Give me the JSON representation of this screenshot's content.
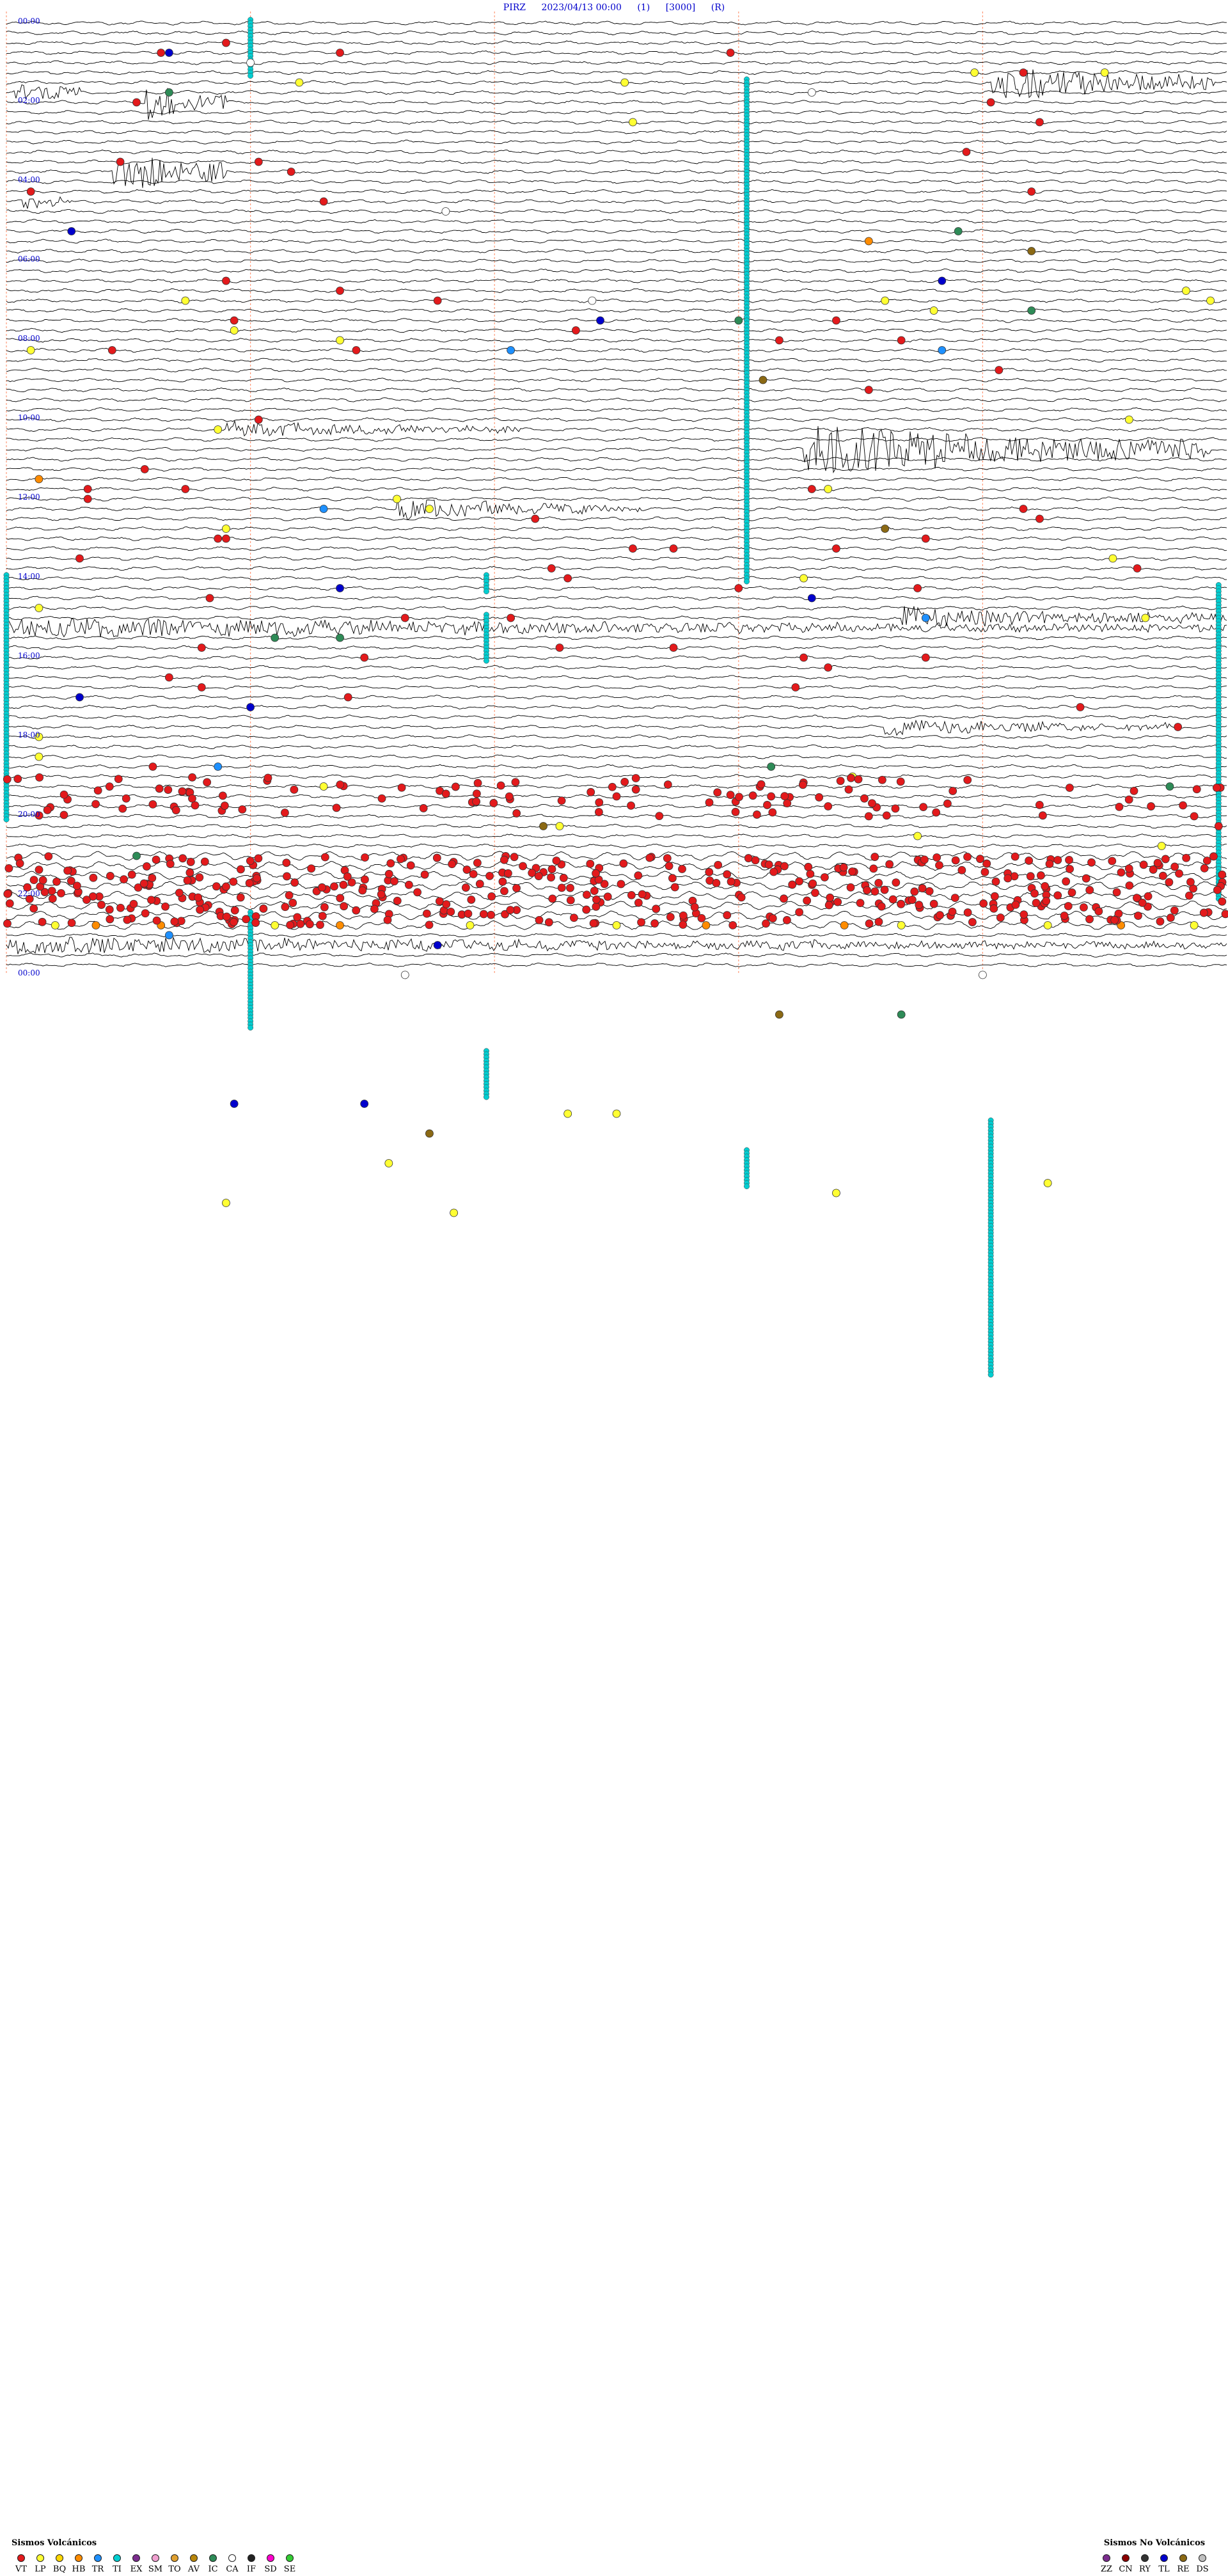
{
  "header": {
    "station": "PIRZ",
    "datetime": "2023/04/13 00:00",
    "channel": "(1)",
    "gain": "[3000]",
    "mode": "(R)"
  },
  "hour_labels": [
    "00:00",
    "02:00",
    "04:00",
    "06:00",
    "08:00",
    "10:00",
    "12:00",
    "14:00",
    "16:00",
    "18:00",
    "20:00",
    "22:00",
    "00:00"
  ],
  "legend_volcanic": {
    "title": "Sismos Volcánicos",
    "items": [
      {
        "code": "VT",
        "color": "#e31a1c"
      },
      {
        "code": "LP",
        "color": "#ffff33"
      },
      {
        "code": "BQ",
        "color": "#ffd700"
      },
      {
        "code": "HB",
        "color": "#ff8c00"
      },
      {
        "code": "TR",
        "color": "#1e90ff"
      },
      {
        "code": "TI",
        "color": "#00ced1"
      },
      {
        "code": "EX",
        "color": "#7b2d8e"
      },
      {
        "code": "SM",
        "color": "#f0a0d0"
      },
      {
        "code": "TO",
        "color": "#e0a030"
      },
      {
        "code": "AV",
        "color": "#b8860b"
      },
      {
        "code": "IC",
        "color": "#2e8b57"
      },
      {
        "code": "CA",
        "color": "#ffffff"
      },
      {
        "code": "IF",
        "color": "#222222"
      },
      {
        "code": "SD",
        "color": "#ff00cc"
      },
      {
        "code": "SE",
        "color": "#33cc33"
      }
    ]
  },
  "legend_nonvolcanic": {
    "title": "Sismos No Volcánicos",
    "items": [
      {
        "code": "ZZ",
        "color": "#7b2d8e"
      },
      {
        "code": "CN",
        "color": "#8b0000"
      },
      {
        "code": "RY",
        "color": "#333333"
      },
      {
        "code": "TL",
        "color": "#0000cc"
      },
      {
        "code": "RE",
        "color": "#8b6914"
      },
      {
        "code": "DS",
        "color": "#c0c0c0"
      }
    ]
  },
  "chart_data": {
    "type": "helicorder",
    "station": "PIRZ",
    "start": "2023/04/13 00:00",
    "rows_per_hour": 4,
    "minutes_per_row": 15,
    "hours": 24,
    "trace_color": "#000000",
    "minute_marker_color": "#ff9977",
    "minute_markers": [
      0,
      3,
      6,
      9,
      12
    ],
    "colors": {
      "VT": "#e31a1c",
      "LP": "#ffff33",
      "HB": "#ff8c00",
      "TR": "#1e90ff",
      "TI": "#00ced1",
      "IC": "#2e8b57",
      "CA": "#ffffff",
      "TL": "#0000cc",
      "RE": "#8b6914"
    },
    "long_events": [
      {
        "code": "TI",
        "minute": 3.0,
        "row_start": 0,
        "row_end": 5
      },
      {
        "code": "TI",
        "minute": 9.1,
        "row_start": 6,
        "row_end": 56
      },
      {
        "code": "TI",
        "minute": 5.9,
        "row_start": 56,
        "row_end": 57
      },
      {
        "code": "TI",
        "minute": 5.9,
        "row_start": 60,
        "row_end": 64
      },
      {
        "code": "TI",
        "minute": 3.0,
        "row_start": 90,
        "row_end": 101
      },
      {
        "code": "TI",
        "minute": 5.9,
        "row_start": 104,
        "row_end": 108
      },
      {
        "code": "TI",
        "minute": 9.1,
        "row_start": 114,
        "row_end": 117
      },
      {
        "code": "TI",
        "minute": 12.1,
        "row_start": 111,
        "row_end": 136
      },
      {
        "code": "TI",
        "minute": 0.0,
        "row_start": 56,
        "row_end": 80
      },
      {
        "code": "TI",
        "minute": 14.9,
        "row_start": 57,
        "row_end": 88
      }
    ],
    "bursts": [
      {
        "minute": 1.7,
        "row": 8,
        "amp": 26,
        "width": 1.0
      },
      {
        "minute": 0.1,
        "row": 7,
        "amp": 14,
        "width": 0.8
      },
      {
        "minute": 1.3,
        "row": 15,
        "amp": 30,
        "width": 1.4
      },
      {
        "minute": 0.2,
        "row": 18,
        "amp": 10,
        "width": 0.6
      },
      {
        "minute": 2.7,
        "row": 41,
        "amp": 10,
        "width": 3.6
      },
      {
        "minute": 9.8,
        "row": 43,
        "amp": 32,
        "width": 5.0
      },
      {
        "minute": 4.8,
        "row": 49,
        "amp": 12,
        "width": 3.0
      },
      {
        "minute": 12.1,
        "row": 6,
        "amp": 22,
        "width": 2.8
      },
      {
        "minute": 11.0,
        "row": 60,
        "amp": 14,
        "width": 4.0
      },
      {
        "minute": 0.0,
        "row": 61,
        "amp": 12,
        "width": 15
      },
      {
        "minute": 10.8,
        "row": 71,
        "amp": 10,
        "width": 3.5
      },
      {
        "minute": 0.0,
        "row": 93,
        "amp": 10,
        "width": 15
      },
      {
        "minute": 10.4,
        "row": 102,
        "amp": 20,
        "width": 3.8
      }
    ],
    "events": [
      {
        "code": "VT",
        "minute": 1.9,
        "row": 3
      },
      {
        "code": "VT",
        "minute": 4.1,
        "row": 3
      },
      {
        "code": "VT",
        "minute": 8.9,
        "row": 3
      },
      {
        "code": "VT",
        "minute": 2.7,
        "row": 2
      },
      {
        "code": "LP",
        "minute": 3.6,
        "row": 6
      },
      {
        "code": "LP",
        "minute": 7.6,
        "row": 6
      },
      {
        "code": "LP",
        "minute": 11.9,
        "row": 5
      },
      {
        "code": "LP",
        "minute": 13.5,
        "row": 5
      },
      {
        "code": "VT",
        "minute": 12.5,
        "row": 5
      },
      {
        "code": "VT",
        "minute": 12.1,
        "row": 8
      },
      {
        "code": "VT",
        "minute": 1.6,
        "row": 8
      },
      {
        "code": "VT",
        "minute": 3.1,
        "row": 14
      },
      {
        "code": "VT",
        "minute": 12.7,
        "row": 10
      },
      {
        "code": "VT",
        "minute": 3.5,
        "row": 15
      },
      {
        "code": "VT",
        "minute": 0.3,
        "row": 17
      },
      {
        "code": "VT",
        "minute": 3.9,
        "row": 18
      },
      {
        "code": "VT",
        "minute": 1.4,
        "row": 14
      },
      {
        "code": "VT",
        "minute": 11.8,
        "row": 13
      },
      {
        "code": "VT",
        "minute": 12.6,
        "row": 17
      },
      {
        "code": "TL",
        "minute": 0.8,
        "row": 21
      },
      {
        "code": "TL",
        "minute": 2.0,
        "row": 3
      },
      {
        "code": "TL",
        "minute": 11.5,
        "row": 26
      },
      {
        "code": "TL",
        "minute": 7.3,
        "row": 30
      },
      {
        "code": "TL",
        "minute": 4.1,
        "row": 57
      },
      {
        "code": "TL",
        "minute": 3.0,
        "row": 69
      },
      {
        "code": "TL",
        "minute": 9.9,
        "row": 58
      },
      {
        "code": "TL",
        "minute": 0.9,
        "row": 68
      },
      {
        "code": "TL",
        "minute": 4.4,
        "row": 109
      },
      {
        "code": "TL",
        "minute": 2.8,
        "row": 109
      },
      {
        "code": "TL",
        "minute": 5.3,
        "row": 93
      },
      {
        "code": "IC",
        "minute": 2.0,
        "row": 7
      },
      {
        "code": "IC",
        "minute": 11.7,
        "row": 21
      },
      {
        "code": "IC",
        "minute": 12.6,
        "row": 29
      },
      {
        "code": "IC",
        "minute": 9.0,
        "row": 30
      },
      {
        "code": "IC",
        "minute": 3.3,
        "row": 62
      },
      {
        "code": "IC",
        "minute": 9.4,
        "row": 75
      },
      {
        "code": "IC",
        "minute": 14.3,
        "row": 77
      },
      {
        "code": "IC",
        "minute": 4.1,
        "row": 62
      },
      {
        "code": "IC",
        "minute": 1.6,
        "row": 84
      },
      {
        "code": "IC",
        "minute": 11.0,
        "row": 100
      },
      {
        "code": "TR",
        "minute": 6.2,
        "row": 33
      },
      {
        "code": "TR",
        "minute": 11.5,
        "row": 33
      },
      {
        "code": "TR",
        "minute": 3.9,
        "row": 49
      },
      {
        "code": "TR",
        "minute": 11.3,
        "row": 60
      },
      {
        "code": "TR",
        "minute": 2.0,
        "row": 92
      },
      {
        "code": "TR",
        "minute": 2.6,
        "row": 75
      },
      {
        "code": "RE",
        "minute": 12.6,
        "row": 23
      },
      {
        "code": "RE",
        "minute": 9.3,
        "row": 36
      },
      {
        "code": "RE",
        "minute": 9.5,
        "row": 100
      },
      {
        "code": "RE",
        "minute": 5.2,
        "row": 112
      },
      {
        "code": "RE",
        "minute": 6.6,
        "row": 81
      },
      {
        "code": "RE",
        "minute": 10.8,
        "row": 51
      },
      {
        "code": "HB",
        "minute": 1.9,
        "row": 91
      },
      {
        "code": "HB",
        "minute": 1.1,
        "row": 91
      },
      {
        "code": "HB",
        "minute": 8.6,
        "row": 91
      },
      {
        "code": "HB",
        "minute": 10.3,
        "row": 91
      },
      {
        "code": "HB",
        "minute": 13.7,
        "row": 91
      },
      {
        "code": "HB",
        "minute": 4.1,
        "row": 91
      },
      {
        "code": "HB",
        "minute": 10.6,
        "row": 22
      },
      {
        "code": "HB",
        "minute": 0.4,
        "row": 46
      },
      {
        "code": "CA",
        "minute": 3.0,
        "row": 4
      },
      {
        "code": "CA",
        "minute": 9.9,
        "row": 7
      },
      {
        "code": "CA",
        "minute": 5.4,
        "row": 19
      },
      {
        "code": "CA",
        "minute": 7.2,
        "row": 28
      },
      {
        "code": "CA",
        "minute": 4.9,
        "row": 96
      },
      {
        "code": "CA",
        "minute": 12.0,
        "row": 96
      },
      {
        "code": "LP",
        "minute": 7.7,
        "row": 10
      },
      {
        "code": "LP",
        "minute": 2.2,
        "row": 28
      },
      {
        "code": "LP",
        "minute": 2.8,
        "row": 31
      },
      {
        "code": "LP",
        "minute": 4.1,
        "row": 32
      },
      {
        "code": "LP",
        "minute": 10.8,
        "row": 28
      },
      {
        "code": "LP",
        "minute": 11.4,
        "row": 29
      },
      {
        "code": "LP",
        "minute": 14.5,
        "row": 27
      },
      {
        "code": "LP",
        "minute": 14.8,
        "row": 28
      },
      {
        "code": "LP",
        "minute": 0.3,
        "row": 33
      },
      {
        "code": "LP",
        "minute": 2.6,
        "row": 41
      },
      {
        "code": "LP",
        "minute": 13.8,
        "row": 40
      },
      {
        "code": "LP",
        "minute": 10.1,
        "row": 47
      },
      {
        "code": "LP",
        "minute": 4.8,
        "row": 48
      },
      {
        "code": "LP",
        "minute": 5.2,
        "row": 49
      },
      {
        "code": "LP",
        "minute": 2.7,
        "row": 51
      },
      {
        "code": "LP",
        "minute": 9.8,
        "row": 56
      },
      {
        "code": "LP",
        "minute": 13.6,
        "row": 54
      },
      {
        "code": "LP",
        "minute": 0.4,
        "row": 59
      },
      {
        "code": "LP",
        "minute": 14.0,
        "row": 60
      },
      {
        "code": "LP",
        "minute": 0.4,
        "row": 72
      },
      {
        "code": "LP",
        "minute": 0.4,
        "row": 74
      },
      {
        "code": "LP",
        "minute": 3.9,
        "row": 77
      },
      {
        "code": "LP",
        "minute": 6.8,
        "row": 81
      },
      {
        "code": "LP",
        "minute": 10.4,
        "row": 76
      },
      {
        "code": "LP",
        "minute": 11.2,
        "row": 82
      },
      {
        "code": "LP",
        "minute": 14.2,
        "row": 83
      },
      {
        "code": "LP",
        "minute": 0.6,
        "row": 91
      },
      {
        "code": "LP",
        "minute": 3.3,
        "row": 91
      },
      {
        "code": "LP",
        "minute": 5.7,
        "row": 91
      },
      {
        "code": "LP",
        "minute": 7.5,
        "row": 91
      },
      {
        "code": "LP",
        "minute": 11.0,
        "row": 91
      },
      {
        "code": "LP",
        "minute": 12.8,
        "row": 91
      },
      {
        "code": "LP",
        "minute": 14.6,
        "row": 91
      },
      {
        "code": "LP",
        "minute": 6.9,
        "row": 110
      },
      {
        "code": "LP",
        "minute": 7.5,
        "row": 110
      },
      {
        "code": "LP",
        "minute": 4.7,
        "row": 115
      },
      {
        "code": "LP",
        "minute": 10.2,
        "row": 118
      },
      {
        "code": "LP",
        "minute": 12.8,
        "row": 117
      },
      {
        "code": "LP",
        "minute": 5.5,
        "row": 120
      },
      {
        "code": "LP",
        "minute": 2.7,
        "row": 119
      },
      {
        "code": "VT",
        "minute": 2.7,
        "row": 26
      },
      {
        "code": "VT",
        "minute": 4.1,
        "row": 27
      },
      {
        "code": "VT",
        "minute": 5.3,
        "row": 28
      },
      {
        "code": "VT",
        "minute": 1.3,
        "row": 33
      },
      {
        "code": "VT",
        "minute": 2.8,
        "row": 30
      },
      {
        "code": "VT",
        "minute": 7.0,
        "row": 31
      },
      {
        "code": "VT",
        "minute": 10.2,
        "row": 30
      },
      {
        "code": "VT",
        "minute": 11.0,
        "row": 32
      },
      {
        "code": "VT",
        "minute": 4.3,
        "row": 33
      },
      {
        "code": "VT",
        "minute": 3.1,
        "row": 40
      },
      {
        "code": "VT",
        "minute": 9.5,
        "row": 32
      },
      {
        "code": "VT",
        "minute": 10.6,
        "row": 37
      },
      {
        "code": "VT",
        "minute": 12.2,
        "row": 35
      },
      {
        "code": "VT",
        "minute": 1.7,
        "row": 45
      },
      {
        "code": "VT",
        "minute": 1.0,
        "row": 47
      },
      {
        "code": "VT",
        "minute": 1.0,
        "row": 48
      },
      {
        "code": "VT",
        "minute": 2.2,
        "row": 47
      },
      {
        "code": "VT",
        "minute": 2.7,
        "row": 52
      },
      {
        "code": "VT",
        "minute": 9.9,
        "row": 47
      },
      {
        "code": "VT",
        "minute": 12.5,
        "row": 49
      },
      {
        "code": "VT",
        "minute": 2.6,
        "row": 52
      },
      {
        "code": "VT",
        "minute": 6.5,
        "row": 50
      },
      {
        "code": "VT",
        "minute": 7.7,
        "row": 53
      },
      {
        "code": "VT",
        "minute": 10.2,
        "row": 53
      },
      {
        "code": "VT",
        "minute": 12.7,
        "row": 50
      },
      {
        "code": "VT",
        "minute": 0.9,
        "row": 54
      },
      {
        "code": "VT",
        "minute": 2.5,
        "row": 58
      },
      {
        "code": "VT",
        "minute": 4.9,
        "row": 60
      },
      {
        "code": "VT",
        "minute": 6.7,
        "row": 55
      },
      {
        "code": "VT",
        "minute": 8.2,
        "row": 53
      },
      {
        "code": "VT",
        "minute": 11.3,
        "row": 52
      },
      {
        "code": "VT",
        "minute": 6.9,
        "row": 56
      },
      {
        "code": "VT",
        "minute": 6.2,
        "row": 60
      },
      {
        "code": "VT",
        "minute": 9.0,
        "row": 57
      },
      {
        "code": "VT",
        "minute": 11.2,
        "row": 57
      },
      {
        "code": "VT",
        "minute": 13.9,
        "row": 55
      },
      {
        "code": "VT",
        "minute": 2.4,
        "row": 63
      },
      {
        "code": "VT",
        "minute": 4.4,
        "row": 64
      },
      {
        "code": "VT",
        "minute": 6.8,
        "row": 63
      },
      {
        "code": "VT",
        "minute": 8.2,
        "row": 63
      },
      {
        "code": "VT",
        "minute": 9.8,
        "row": 64
      },
      {
        "code": "VT",
        "minute": 10.1,
        "row": 65
      },
      {
        "code": "VT",
        "minute": 11.3,
        "row": 64
      },
      {
        "code": "VT",
        "minute": 2.0,
        "row": 66
      },
      {
        "code": "VT",
        "minute": 2.4,
        "row": 67
      },
      {
        "code": "VT",
        "minute": 4.2,
        "row": 68
      },
      {
        "code": "VT",
        "minute": 9.7,
        "row": 67
      },
      {
        "code": "VT",
        "minute": 13.2,
        "row": 69
      },
      {
        "code": "VT",
        "minute": 14.4,
        "row": 71
      },
      {
        "code": "VT",
        "minute": 1.8,
        "row": 75
      },
      {
        "code": "VT",
        "minute": 10.1,
        "row": 79
      },
      {
        "code": "VT",
        "minute": 10.6,
        "row": 80
      },
      {
        "code": "VT",
        "minute": 14.6,
        "row": 80
      },
      {
        "code": "VT",
        "minute": 7.5,
        "row": 78
      },
      {
        "code": "VT",
        "minute": 9.4,
        "row": 78
      },
      {
        "code": "VT",
        "minute": 14.9,
        "row": 81
      }
    ],
    "dense_band": {
      "code": "VT",
      "row_start": 84,
      "row_end": 91,
      "count": 420,
      "seed": 7
    },
    "secondary_band": {
      "code": "VT",
      "row_start": 76,
      "row_end": 80,
      "count": 110,
      "seed": 11
    }
  }
}
